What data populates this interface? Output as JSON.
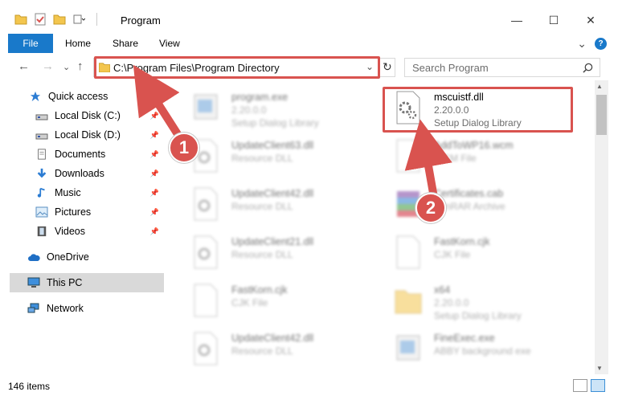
{
  "window": {
    "title": "Program",
    "minimize": "—",
    "maximize": "☐",
    "close": "✕"
  },
  "ribbon": {
    "tabs": [
      "File",
      "Home",
      "Share",
      "View"
    ],
    "expand": "⌄",
    "help": "?"
  },
  "nav": {
    "back": "←",
    "forward": "→",
    "recent": "⌄",
    "up": "↑",
    "address": "C:\\Program Files\\Program Directory",
    "address_dropdown": "⌄",
    "refresh": "↻",
    "search_placeholder": "Search Program",
    "search_icon": "search-icon"
  },
  "sidebar": {
    "items": [
      {
        "label": "Quick access",
        "icon": "star-icon"
      },
      {
        "label": "Local Disk (C:)",
        "icon": "drive-icon",
        "pinned": true
      },
      {
        "label": "Local Disk (D:)",
        "icon": "drive-icon",
        "pinned": true
      },
      {
        "label": "Documents",
        "icon": "documents-icon",
        "pinned": true
      },
      {
        "label": "Downloads",
        "icon": "downloads-icon",
        "pinned": true
      },
      {
        "label": "Music",
        "icon": "music-icon",
        "pinned": true
      },
      {
        "label": "Pictures",
        "icon": "pictures-icon",
        "pinned": true
      },
      {
        "label": "Videos",
        "icon": "videos-icon",
        "pinned": true
      },
      {
        "label": "OneDrive",
        "icon": "cloud-icon"
      },
      {
        "label": "This PC",
        "icon": "computer-icon",
        "selected": true
      },
      {
        "label": "Network",
        "icon": "network-icon"
      }
    ]
  },
  "files": [
    {
      "name": "program.exe",
      "line2": "2.20.0.0",
      "line3": "Setup Dialog Library",
      "icon": "exe-icon",
      "blurred": true
    },
    {
      "name": "mscuistf.dll",
      "line2": "2.20.0.0",
      "line3": "Setup Dialog Library",
      "icon": "dll-gear-icon",
      "blurred": false
    },
    {
      "name": "UpdateClient63.dll",
      "line2": "Resource DLL",
      "icon": "dll-gear-icon",
      "blurred": true
    },
    {
      "name": "AddToWP16.wcm",
      "line2": "WCM File",
      "icon": "file-icon",
      "blurred": true
    },
    {
      "name": "UpdateClient42.dll",
      "line2": "Resource DLL",
      "icon": "dll-gear-icon",
      "blurred": true
    },
    {
      "name": "Certificates.cab",
      "line2": "WinRAR Archive",
      "icon": "archive-icon",
      "blurred": true
    },
    {
      "name": "UpdateClient21.dll",
      "line2": "Resource DLL",
      "icon": "dll-gear-icon",
      "blurred": true
    },
    {
      "name": "FastKorn.cjk",
      "line2": "CJK File",
      "icon": "file-icon",
      "blurred": true
    },
    {
      "name": "FastKorn.cjk",
      "line2": "CJK File",
      "icon": "file-icon",
      "blurred": true
    },
    {
      "name": "x64",
      "line2": "2.20.0.0",
      "line3": "Setup Dialog Library",
      "icon": "folder-icon",
      "blurred": true
    },
    {
      "name": "UpdateClient42.dll",
      "line2": "Resource DLL",
      "icon": "dll-gear-icon",
      "blurred": true
    },
    {
      "name": "FineExec.exe",
      "line2": "ABBY background exe",
      "icon": "exe-icon",
      "blurred": true
    }
  ],
  "status": {
    "item_count": "146 items"
  },
  "annotations": {
    "step1": "1",
    "step2": "2"
  },
  "colors": {
    "accent": "#1979ca",
    "highlight": "#d9534f",
    "selected_bg": "#d9d9d9"
  }
}
